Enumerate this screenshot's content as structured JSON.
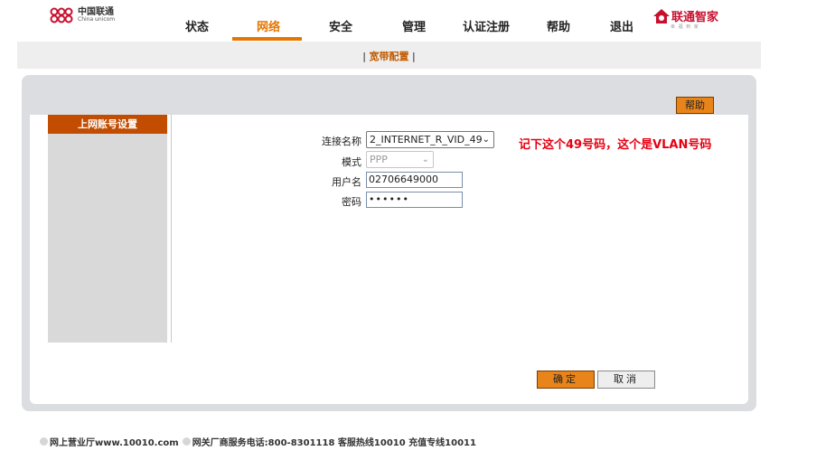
{
  "header": {
    "logo_cn": "中国联通",
    "logo_en": "China unicom",
    "brand_title": "联通智家",
    "brand_sub": "幸 福 到 家",
    "nav": [
      "状态",
      "网络",
      "安全",
      "管理",
      "认证注册",
      "帮助",
      "退出"
    ],
    "active_nav": "网络"
  },
  "subnav": {
    "prefix": "| ",
    "link": "宽带配置",
    "suffix": " |"
  },
  "panel": {
    "help_label": "帮助",
    "sidebar_title": "上网账号设置"
  },
  "form": {
    "connection_name_label": "连接名称",
    "connection_name_value": "2_INTERNET_R_VID_49",
    "mode_label": "模式",
    "mode_value": "PPP",
    "username_label": "用户名",
    "username_value": "02706649000",
    "password_label": "密码",
    "password_value": "••••••"
  },
  "annotation": "记下这个49号码，这个是VLAN号码",
  "buttons": {
    "ok_label": "确定",
    "cancel_label": "取消"
  },
  "footer": {
    "item1": "网上营业厅www.10010.com",
    "item2": "网关厂商服务电话:800-8301118 客服热线10010 充值专线10011"
  },
  "colors": {
    "accent": "#e57600",
    "sidebar_header": "#c24d00",
    "annotation": "#e60012",
    "brand_red": "#c8102e"
  }
}
